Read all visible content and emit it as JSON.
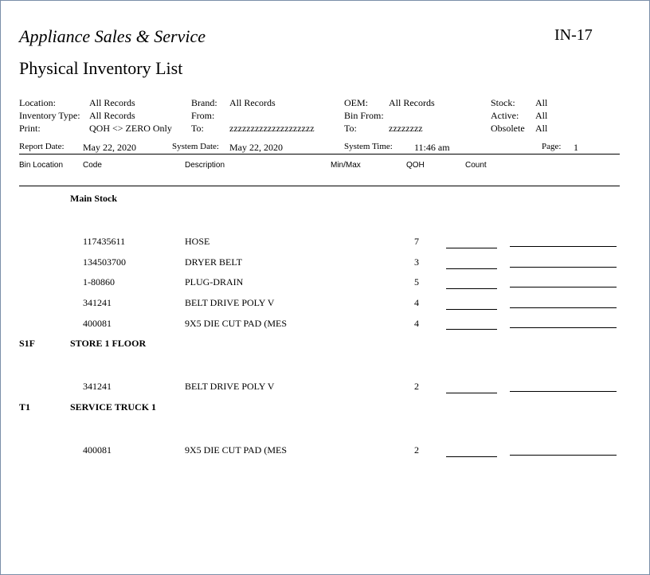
{
  "header": {
    "company": "Appliance Sales & Service",
    "report_code": "IN-17",
    "title": "Physical Inventory List"
  },
  "criteria": {
    "location_label": "Location:",
    "location_value": "All Records",
    "inventory_type_label": "Inventory Type:",
    "inventory_type_value": "All Records",
    "print_label": "Print:",
    "print_value": "QOH <> ZERO Only",
    "brand_label": "Brand:",
    "brand_value": "All Records",
    "from_label": "From:",
    "from_value": "",
    "to_label": "To:",
    "to_value": "zzzzzzzzzzzzzzzzzzzz",
    "oem_label": "OEM:",
    "oem_value": "All Records",
    "bin_from_label": "Bin From:",
    "bin_from_value": "",
    "bin_to_label": "To:",
    "bin_to_value": "zzzzzzzz",
    "stock_label": "Stock:",
    "stock_value": "All",
    "active_label": "Active:",
    "active_value": "All",
    "obsolete_label": "Obsolete",
    "obsolete_value": "All"
  },
  "report_info": {
    "report_date_label": "Report Date:",
    "report_date": "May 22, 2020",
    "system_date_label": "System Date:",
    "system_date": "May 22, 2020",
    "system_time_label": "System Time:",
    "system_time": "11:46 am",
    "page_label": "Page:",
    "page": "1"
  },
  "columns": {
    "bin_location": "Bin Location",
    "code": "Code",
    "description": "Description",
    "min_max": "Min/Max",
    "qoh": "QOH",
    "count": "Count"
  },
  "groups": [
    {
      "bin": "",
      "name": "Main Stock",
      "items": [
        {
          "code": "117435611",
          "description": "HOSE",
          "qoh": "7"
        },
        {
          "code": "134503700",
          "description": "DRYER BELT",
          "qoh": "3"
        },
        {
          "code": "1-80860",
          "description": "PLUG-DRAIN",
          "qoh": "5"
        },
        {
          "code": "341241",
          "description": "BELT DRIVE POLY V",
          "qoh": "4"
        },
        {
          "code": "400081",
          "description": "9X5 DIE CUT PAD (MES",
          "qoh": "4"
        }
      ]
    },
    {
      "bin": "S1F",
      "name": "STORE 1 FLOOR",
      "items": [
        {
          "code": "341241",
          "description": "BELT DRIVE POLY V",
          "qoh": "2"
        }
      ]
    },
    {
      "bin": "T1",
      "name": "SERVICE TRUCK 1",
      "items": [
        {
          "code": "400081",
          "description": "9X5 DIE CUT PAD (MES",
          "qoh": "2"
        }
      ]
    }
  ]
}
